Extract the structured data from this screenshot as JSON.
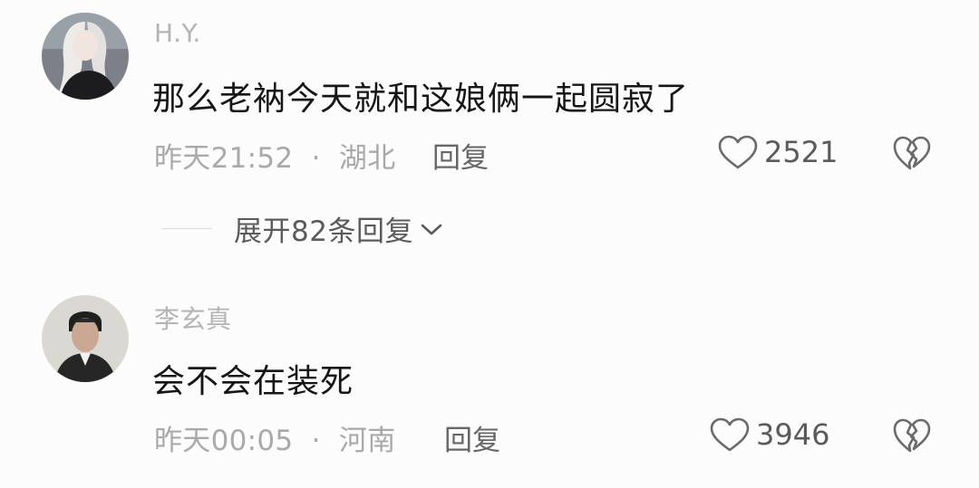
{
  "comments": [
    {
      "username": "H.Y.",
      "text": "那么老衲今天就和这娘俩一起圆寂了",
      "time": "昨天21:52",
      "separator": "·",
      "location": "湖北",
      "reply_label": "回复",
      "likes": "2521",
      "expand_label": "展开82条回复"
    },
    {
      "username": "李玄真",
      "text": "会不会在装死",
      "time": "昨天00:05",
      "separator": "·",
      "location": "河南",
      "reply_label": "回复",
      "likes": "3946"
    }
  ],
  "colors": {
    "background": "#fcfcfc",
    "username": "#b4b4b4",
    "comment_text": "#161616",
    "meta": "#a9a9a9",
    "icon": "#6a6a6a"
  },
  "icons": [
    "heart-outline-icon",
    "broken-heart-icon",
    "chevron-down-icon"
  ]
}
